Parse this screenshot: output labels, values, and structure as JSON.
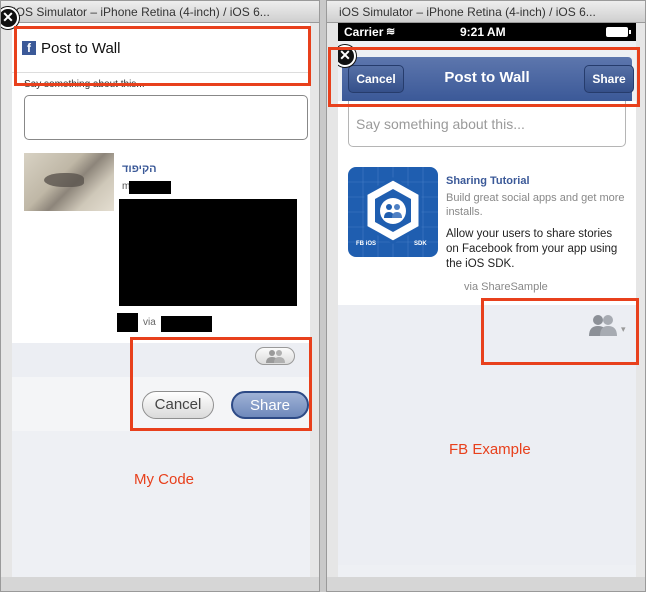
{
  "left_window": {
    "title": "iOS Simulator – iPhone Retina (4-inch) / iOS 6...",
    "dialog": {
      "title": "Post to Wall",
      "fb_glyph": "f",
      "close_glyph": "✕",
      "hint": "Say something about this...",
      "input_value": "",
      "link_title": "הקיפוד",
      "meta_prefix": "m",
      "via_label": "via",
      "cancel_label": "Cancel",
      "share_label": "Share"
    },
    "caption": "My Code"
  },
  "right_window": {
    "title": "iOS Simulator – iPhone Retina (4-inch) / iOS 6...",
    "status_bar": {
      "carrier": "Carrier",
      "wifi_glyph": "≋",
      "time": "9:21 AM"
    },
    "dialog": {
      "close_glyph": "✕",
      "cancel_label": "Cancel",
      "title": "Post to Wall",
      "share_label": "Share",
      "placeholder": "Say something about this...",
      "app_title": "Sharing Tutorial",
      "app_desc": "Build great social apps and get more installs.",
      "app_body": "Allow your users to share stories on Facebook from your app using the iOS SDK.",
      "via_text": "via ShareSample",
      "app_icon_left_label": "FB iOS",
      "app_icon_right_label": "SDK",
      "audience_caret": "▾"
    },
    "caption": "FB Example"
  },
  "colors": {
    "facebook_blue": "#3b5998",
    "highlight_red": "#e8401c",
    "caption_red": "#e8401c"
  },
  "icons": [
    "close-icon",
    "facebook-logo-icon",
    "people-icon",
    "wifi-icon",
    "battery-icon",
    "caret-down-icon"
  ]
}
